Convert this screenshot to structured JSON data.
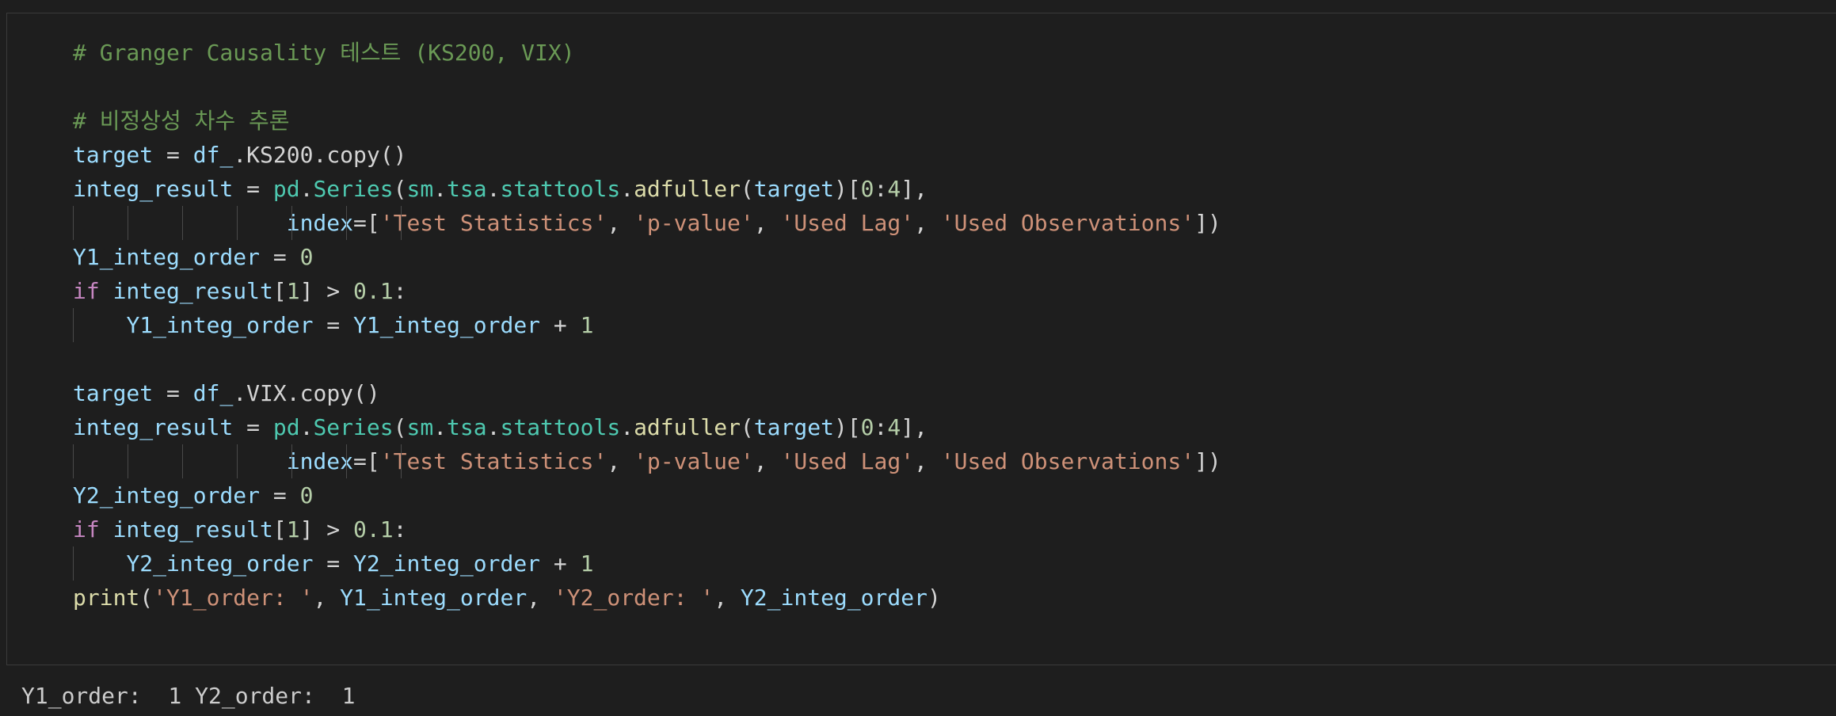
{
  "colors": {
    "background": "#1e1e1e",
    "comment": "#6a9955",
    "variable": "#9cdcfe",
    "string": "#ce9178",
    "number": "#b5cea8",
    "keyword": "#c586c0",
    "function": "#dcdcaa",
    "class": "#4ec9b0",
    "text": "#d4d4d4"
  },
  "cell": {
    "lines": [
      [
        [
          "c-comment",
          "# Granger Causality 테스트 (KS200, VIX)"
        ]
      ],
      [],
      [
        [
          "c-comment",
          "# 비정상성 차수 추론"
        ]
      ],
      [
        [
          "c-var",
          "target"
        ],
        [
          "c-op",
          " = "
        ],
        [
          "c-var",
          "df_"
        ],
        [
          "c-plain",
          ".KS200.copy()"
        ]
      ],
      [
        [
          "c-var",
          "integ_result"
        ],
        [
          "c-op",
          " = "
        ],
        [
          "c-cls",
          "pd"
        ],
        [
          "c-plain",
          "."
        ],
        [
          "c-cls",
          "Series"
        ],
        [
          "c-plain",
          "("
        ],
        [
          "c-cls",
          "sm"
        ],
        [
          "c-plain",
          "."
        ],
        [
          "c-cls",
          "tsa"
        ],
        [
          "c-plain",
          "."
        ],
        [
          "c-cls",
          "stattools"
        ],
        [
          "c-plain",
          "."
        ],
        [
          "c-fn",
          "adfuller"
        ],
        [
          "c-plain",
          "("
        ],
        [
          "c-var",
          "target"
        ],
        [
          "c-plain",
          ")["
        ],
        [
          "c-num",
          "0"
        ],
        [
          "c-plain",
          ":"
        ],
        [
          "c-num",
          "4"
        ],
        [
          "c-plain",
          "],"
        ]
      ],
      [
        [
          "c-plain",
          "                "
        ],
        [
          "c-var",
          "index"
        ],
        [
          "c-op",
          "="
        ],
        [
          "c-plain",
          "["
        ],
        [
          "c-str",
          "'Test Statistics'"
        ],
        [
          "c-plain",
          ", "
        ],
        [
          "c-str",
          "'p-value'"
        ],
        [
          "c-plain",
          ", "
        ],
        [
          "c-str",
          "'Used Lag'"
        ],
        [
          "c-plain",
          ", "
        ],
        [
          "c-str",
          "'Used Observations'"
        ],
        [
          "c-plain",
          "])"
        ]
      ],
      [
        [
          "c-var",
          "Y1_integ_order"
        ],
        [
          "c-op",
          " = "
        ],
        [
          "c-num",
          "0"
        ]
      ],
      [
        [
          "c-kw",
          "if"
        ],
        [
          "c-plain",
          " "
        ],
        [
          "c-var",
          "integ_result"
        ],
        [
          "c-plain",
          "["
        ],
        [
          "c-num",
          "1"
        ],
        [
          "c-plain",
          "] > "
        ],
        [
          "c-num",
          "0.1"
        ],
        [
          "c-plain",
          ":"
        ]
      ],
      [
        [
          "c-plain",
          "    "
        ],
        [
          "c-var",
          "Y1_integ_order"
        ],
        [
          "c-op",
          " = "
        ],
        [
          "c-var",
          "Y1_integ_order"
        ],
        [
          "c-op",
          " + "
        ],
        [
          "c-num",
          "1"
        ]
      ],
      [],
      [
        [
          "c-var",
          "target"
        ],
        [
          "c-op",
          " = "
        ],
        [
          "c-var",
          "df_"
        ],
        [
          "c-plain",
          ".VIX.copy()"
        ]
      ],
      [
        [
          "c-var",
          "integ_result"
        ],
        [
          "c-op",
          " = "
        ],
        [
          "c-cls",
          "pd"
        ],
        [
          "c-plain",
          "."
        ],
        [
          "c-cls",
          "Series"
        ],
        [
          "c-plain",
          "("
        ],
        [
          "c-cls",
          "sm"
        ],
        [
          "c-plain",
          "."
        ],
        [
          "c-cls",
          "tsa"
        ],
        [
          "c-plain",
          "."
        ],
        [
          "c-cls",
          "stattools"
        ],
        [
          "c-plain",
          "."
        ],
        [
          "c-fn",
          "adfuller"
        ],
        [
          "c-plain",
          "("
        ],
        [
          "c-var",
          "target"
        ],
        [
          "c-plain",
          ")["
        ],
        [
          "c-num",
          "0"
        ],
        [
          "c-plain",
          ":"
        ],
        [
          "c-num",
          "4"
        ],
        [
          "c-plain",
          "],"
        ]
      ],
      [
        [
          "c-plain",
          "                "
        ],
        [
          "c-var",
          "index"
        ],
        [
          "c-op",
          "="
        ],
        [
          "c-plain",
          "["
        ],
        [
          "c-str",
          "'Test Statistics'"
        ],
        [
          "c-plain",
          ", "
        ],
        [
          "c-str",
          "'p-value'"
        ],
        [
          "c-plain",
          ", "
        ],
        [
          "c-str",
          "'Used Lag'"
        ],
        [
          "c-plain",
          ", "
        ],
        [
          "c-str",
          "'Used Observations'"
        ],
        [
          "c-plain",
          "])"
        ]
      ],
      [
        [
          "c-var",
          "Y2_integ_order"
        ],
        [
          "c-op",
          " = "
        ],
        [
          "c-num",
          "0"
        ]
      ],
      [
        [
          "c-kw",
          "if"
        ],
        [
          "c-plain",
          " "
        ],
        [
          "c-var",
          "integ_result"
        ],
        [
          "c-plain",
          "["
        ],
        [
          "c-num",
          "1"
        ],
        [
          "c-plain",
          "] > "
        ],
        [
          "c-num",
          "0.1"
        ],
        [
          "c-plain",
          ":"
        ]
      ],
      [
        [
          "c-plain",
          "    "
        ],
        [
          "c-var",
          "Y2_integ_order"
        ],
        [
          "c-op",
          " = "
        ],
        [
          "c-var",
          "Y2_integ_order"
        ],
        [
          "c-op",
          " + "
        ],
        [
          "c-num",
          "1"
        ]
      ],
      [
        [
          "c-fn",
          "print"
        ],
        [
          "c-plain",
          "("
        ],
        [
          "c-str",
          "'Y1_order: '"
        ],
        [
          "c-plain",
          ", "
        ],
        [
          "c-var",
          "Y1_integ_order"
        ],
        [
          "c-plain",
          ", "
        ],
        [
          "c-str",
          "'Y2_order: '"
        ],
        [
          "c-plain",
          ", "
        ],
        [
          "c-var",
          "Y2_integ_order"
        ],
        [
          "c-plain",
          ")"
        ]
      ]
    ]
  },
  "output": {
    "text": "Y1_order:  1 Y2_order:  1"
  }
}
